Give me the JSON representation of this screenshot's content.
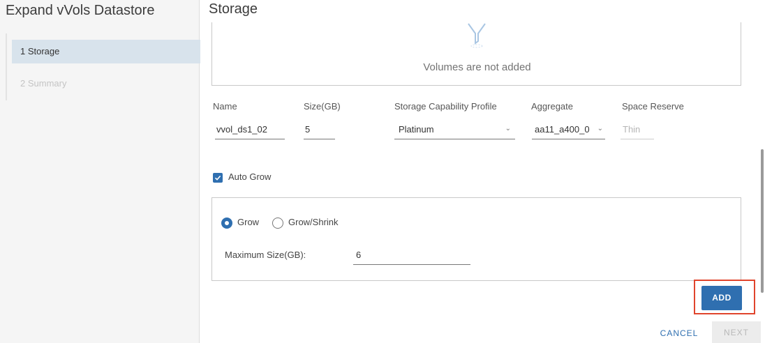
{
  "wizard": {
    "title": "Expand vVols Datastore",
    "steps": [
      {
        "label": "1  Storage"
      },
      {
        "label": "2  Summary"
      }
    ]
  },
  "page": {
    "title": "Storage"
  },
  "volumes": {
    "empty_text": "Volumes are not added",
    "empty_icon": "funnel-filter-icon"
  },
  "form": {
    "name_label": "Name",
    "name_value": "vvol_ds1_02",
    "size_label": "Size(GB)",
    "size_value": "5",
    "profile_label": "Storage Capability Profile",
    "profile_value": "Platinum",
    "aggregate_label": "Aggregate",
    "aggregate_value": "aa11_a400_0",
    "reserve_label": "Space Reserve",
    "reserve_value": "Thin"
  },
  "auto_grow": {
    "label": "Auto Grow",
    "checked": true,
    "grow_label": "Grow",
    "grow_shrink_label": "Grow/Shrink",
    "selected": "Grow",
    "max_size_label": "Maximum Size(GB):",
    "max_size_value": "6"
  },
  "actions": {
    "add_label": "ADD",
    "cancel_label": "CANCEL",
    "next_label": "NEXT"
  },
  "colors": {
    "accent": "#2f6fb0",
    "highlight": "#e0442c",
    "active_step": "#d8e3ec"
  }
}
